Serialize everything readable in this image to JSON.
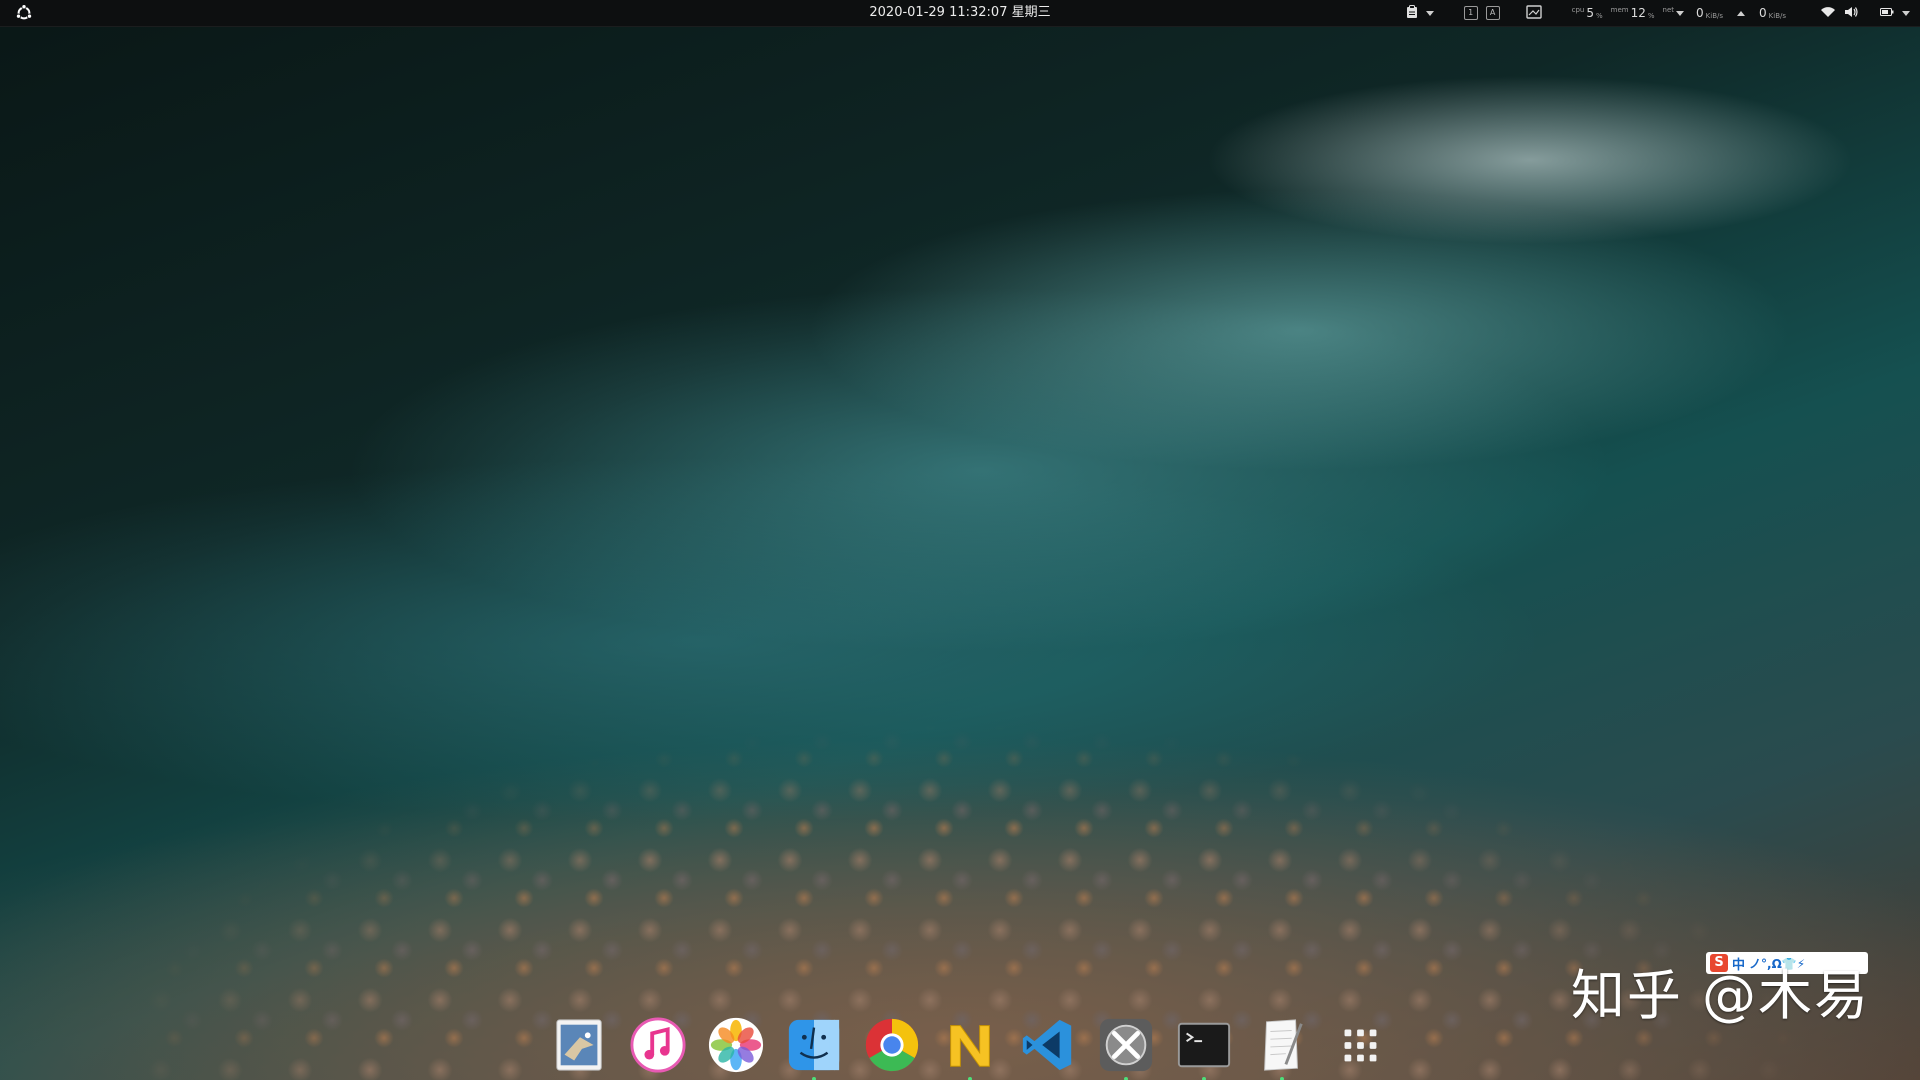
{
  "top_panel": {
    "clock": "2020-01-29 11:32:07 星期三",
    "cpu_label": "cpu",
    "cpu_value": "5",
    "cpu_unit": "%",
    "mem_label": "mem",
    "mem_value": "12",
    "mem_unit": "%",
    "net_label": "net",
    "net_down_value": "0",
    "net_down_unit": "KiB/s",
    "net_up_value": "0",
    "net_up_unit": "KiB/s"
  },
  "ime": {
    "logo": "S",
    "mode": "中",
    "tools": "ノ°,Ω👕⚡"
  },
  "watermark": {
    "text": "知乎 @木易"
  },
  "dock": {
    "items": [
      {
        "name": "mail-app",
        "icon": "stamp-eagle-icon",
        "running": false
      },
      {
        "name": "itunes",
        "icon": "music-note-icon",
        "running": false
      },
      {
        "name": "photos",
        "icon": "photos-flower-icon",
        "running": false
      },
      {
        "name": "finder",
        "icon": "finder-face-icon",
        "running": true
      },
      {
        "name": "chrome",
        "icon": "chrome-icon",
        "running": false
      },
      {
        "name": "notes",
        "icon": "n-note-icon",
        "running": true
      },
      {
        "name": "vscode",
        "icon": "vscode-icon",
        "running": false
      },
      {
        "name": "settings",
        "icon": "tools-icon",
        "running": true
      },
      {
        "name": "terminal",
        "icon": "terminal-icon",
        "running": true
      },
      {
        "name": "text-editor",
        "icon": "paper-pen-icon",
        "running": true
      },
      {
        "name": "app-grid",
        "icon": "app-grid-icon",
        "running": false
      }
    ]
  },
  "colors": {
    "panel_bg": "#0d0f10",
    "running_indicator": "#4de07a"
  }
}
